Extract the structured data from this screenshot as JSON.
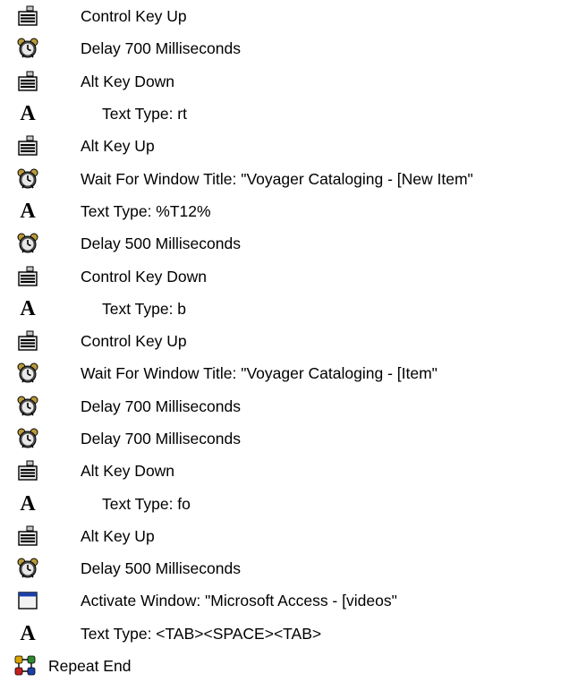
{
  "macro": {
    "steps": [
      {
        "label": "Control Key Up",
        "icon": "keyboard-icon"
      },
      {
        "label": "Delay 700 Milliseconds",
        "icon": "alarm-clock-icon"
      },
      {
        "label": "Alt Key Down",
        "icon": "keyboard-icon"
      },
      {
        "label": "Text Type: rt",
        "icon": "text-type-icon"
      },
      {
        "label": "Alt Key Up",
        "icon": "keyboard-icon"
      },
      {
        "label": "Wait For Window Title: \"Voyager Cataloging - [New Item\"",
        "icon": "alarm-clock-icon"
      },
      {
        "label": "Text Type: %T12%",
        "icon": "text-type-icon"
      },
      {
        "label": "Delay 500 Milliseconds",
        "icon": "alarm-clock-icon"
      },
      {
        "label": "Control Key Down",
        "icon": "keyboard-icon"
      },
      {
        "label": "Text Type: b",
        "icon": "text-type-icon"
      },
      {
        "label": "Control Key Up",
        "icon": "keyboard-icon"
      },
      {
        "label": "Wait For Window Title: \"Voyager Cataloging - [Item\"",
        "icon": "alarm-clock-icon"
      },
      {
        "label": "Delay 700 Milliseconds",
        "icon": "alarm-clock-icon"
      },
      {
        "label": "Delay 700 Milliseconds",
        "icon": "alarm-clock-icon"
      },
      {
        "label": "Alt Key Down",
        "icon": "keyboard-icon"
      },
      {
        "label": "Text Type: fo",
        "icon": "text-type-icon"
      },
      {
        "label": "Alt Key Up",
        "icon": "keyboard-icon"
      },
      {
        "label": "Delay 500 Milliseconds",
        "icon": "alarm-clock-icon"
      },
      {
        "label": "Activate Window: \"Microsoft Access - [videos\"",
        "icon": "window-icon"
      },
      {
        "label": "Text Type: <TAB><SPACE><TAB>",
        "icon": "text-type-icon"
      },
      {
        "label": "Repeat End",
        "icon": "repeat-icon"
      }
    ]
  }
}
